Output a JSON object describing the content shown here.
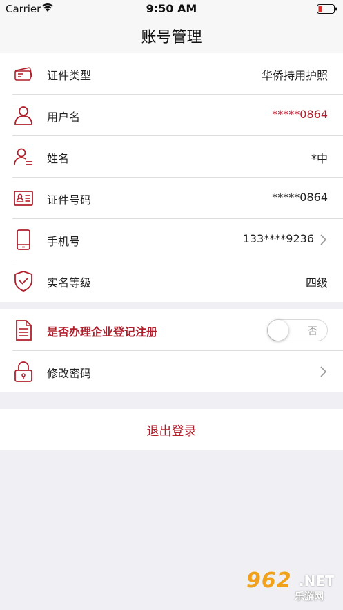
{
  "status_bar": {
    "carrier": "Carrier",
    "time": "9:50 AM"
  },
  "nav": {
    "title": "账号管理"
  },
  "info_rows": [
    {
      "label": "证件类型",
      "value": "华侨持用护照",
      "icon": "id-card-icon"
    },
    {
      "label": "用户名",
      "value": "*****0864",
      "icon": "user-icon"
    },
    {
      "label": "姓名",
      "value": "*中",
      "icon": "user-name-icon"
    },
    {
      "label": "证件号码",
      "value": "*****0864",
      "icon": "id-number-icon"
    },
    {
      "label": "手机号",
      "value": "133****9236",
      "icon": "phone-icon"
    },
    {
      "label": "实名等级",
      "value": "四级",
      "icon": "shield-check-icon"
    }
  ],
  "settings_rows": {
    "enterprise": {
      "label": "是否办理企业登记注册",
      "toggle_text": "否",
      "icon": "document-icon"
    },
    "password": {
      "label": "修改密码",
      "icon": "lock-icon"
    }
  },
  "logout": {
    "label": "退出登录"
  },
  "watermark": {
    "number": "962",
    "suffix": ".NET",
    "sub": "乐游网"
  },
  "colors": {
    "accent": "#b01f2c",
    "background": "#efeff4"
  }
}
